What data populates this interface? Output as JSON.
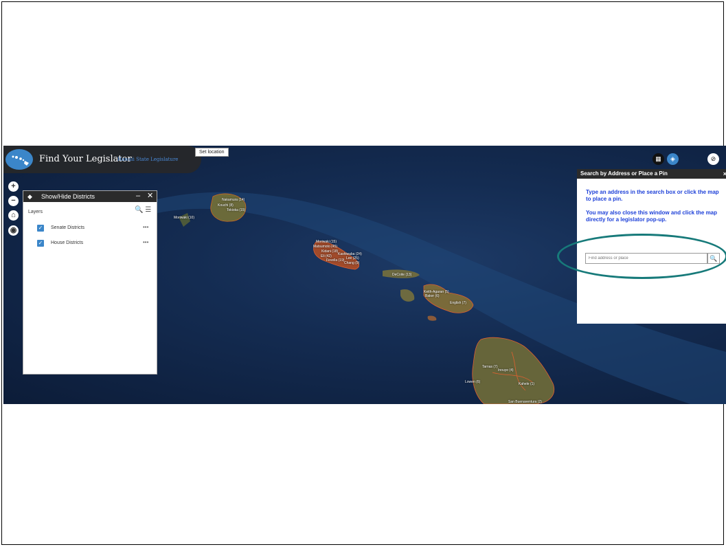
{
  "header": {
    "title": "Find Your Legislator",
    "subtitle": "Hawaii State Legislature",
    "set_location": "Set location"
  },
  "map_controls": {
    "zoom_in": "+",
    "zoom_out": "−",
    "home": "⌂",
    "locate": "◉"
  },
  "layer_panel": {
    "title": "Show/Hide Districts",
    "minimize": "–",
    "close": "✕",
    "section_label": "Layers",
    "tools": "🔍 ☰",
    "layers": [
      {
        "label": "Senate Districts",
        "checked": "✓",
        "more": "•••"
      },
      {
        "label": "House Districts",
        "checked": "✓",
        "more": "•••"
      }
    ]
  },
  "top_right": {
    "grid": "▦",
    "basemap": "◈",
    "visibility": "⊘"
  },
  "search_panel": {
    "title": "Search by Address or Place a Pin",
    "close": "×",
    "instruction_1": "Type an address in the search box or click the map to place a pin.",
    "instruction_2": "You may also close this window and click the map directly for a legislator pop-up.",
    "placeholder": "Find address or place",
    "search_icon": "🔍"
  },
  "map_labels": [
    {
      "text": "Nakamura (14)"
    },
    {
      "text": "Kouchi (8)"
    },
    {
      "text": "Tokioka (15)"
    },
    {
      "text": "Moriwaki (10)"
    },
    {
      "text": "Moriwaki (15)"
    },
    {
      "text": "Matsumoto (45)"
    },
    {
      "text": "Kidani (18)"
    },
    {
      "text": "Kashiwaba (24)"
    },
    {
      "text": "Lee (25)"
    },
    {
      "text": "Fevella (19)"
    },
    {
      "text": "Chang (9)"
    },
    {
      "text": "Eli (42)"
    },
    {
      "text": "DeCoite (13)"
    },
    {
      "text": "Keith-Agaran (5)"
    },
    {
      "text": "Baker (6)"
    },
    {
      "text": "English (7)"
    },
    {
      "text": "Tarnas (7)"
    },
    {
      "text": "Inouye (4)"
    },
    {
      "text": "Lowen (6)"
    },
    {
      "text": "Kahele (1)"
    },
    {
      "text": "San Buenaventura (2)"
    }
  ],
  "colors": {
    "accent": "#3b86c9",
    "ocean": "#142c52",
    "panel_header": "#2b2b2b",
    "instruction_text": "#1c3fd8",
    "annotation": "#177a7a"
  }
}
